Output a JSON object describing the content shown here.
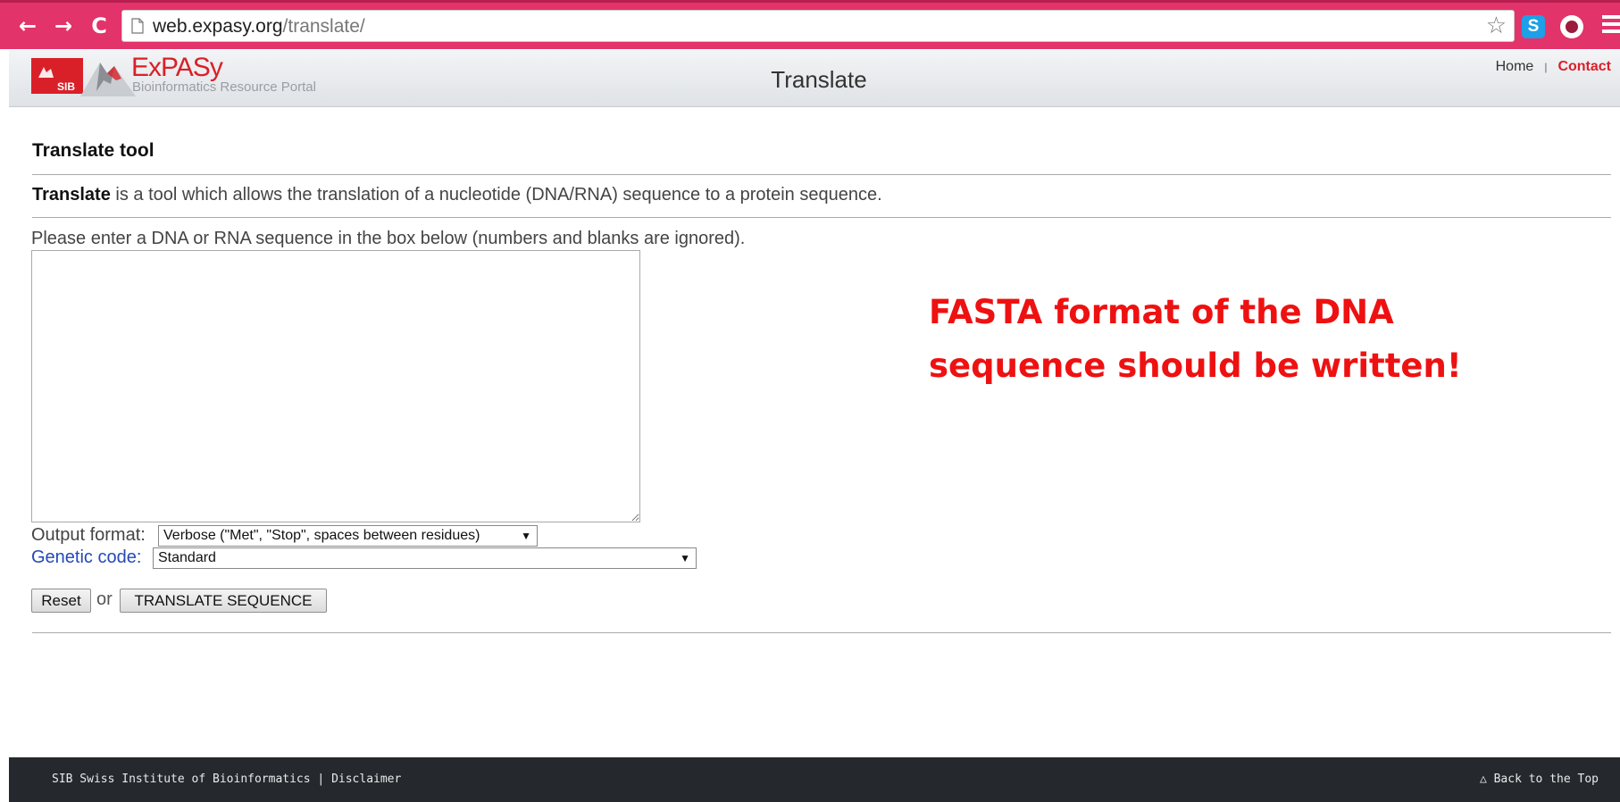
{
  "browser": {
    "back_icon": "←",
    "forward_icon": "→",
    "reload_icon": "C",
    "url_host": "web.expasy.org",
    "url_path": "/translate/",
    "bookmark_icon": "☆",
    "extension_s_label": "S"
  },
  "header": {
    "sib_label": "SIB",
    "brand": "ExPASy",
    "tagline": "Bioinformatics Resource Portal",
    "title": "Translate",
    "nav_home": "Home",
    "nav_separator": "|",
    "nav_contact": "Contact"
  },
  "main": {
    "tool_title": "Translate tool",
    "intro_bold": "Translate",
    "intro_rest": " is a tool which allows the translation of a nucleotide (DNA/RNA) sequence to a protein sequence.",
    "instructions": "Please enter a DNA or RNA sequence in the box below (numbers and blanks are ignored).",
    "sequence_value": "",
    "output_format_label": "Output format:",
    "output_format_value": "Verbose (\"Met\", \"Stop\", spaces between residues)",
    "genetic_code_label": "Genetic code:",
    "genetic_code_value": "Standard",
    "select_arrow": "▼",
    "reset_label": "Reset",
    "or_label": "or",
    "translate_label": "TRANSLATE SEQUENCE"
  },
  "annotation": {
    "line1": "FASTA format of the DNA",
    "line2": "sequence should be written!"
  },
  "footer": {
    "left": "SIB Swiss Institute of Bioinformatics | Disclaimer",
    "right": "△ Back to the Top"
  },
  "colors": {
    "chrome": "#e2336a",
    "brand_red": "#d92028",
    "link_blue": "#2548b5",
    "annotation_red": "#ee1111",
    "footer_bg": "#25292d"
  }
}
